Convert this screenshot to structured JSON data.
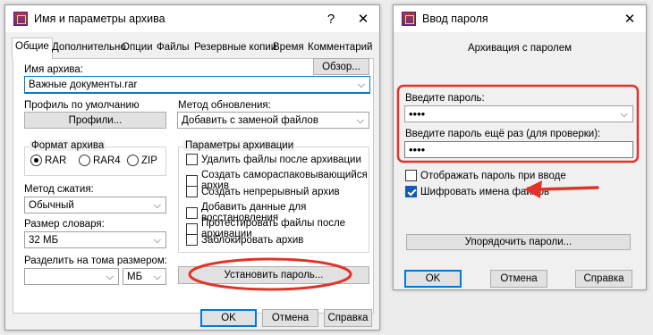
{
  "left_window": {
    "title": "Имя и параметры архива",
    "help_glyph": "?",
    "close_glyph": "✕",
    "tabs": [
      "Общие",
      "Дополнительно",
      "Опции",
      "Файлы",
      "Резервные копии",
      "Время",
      "Комментарий"
    ],
    "archive_name_label": "Имя архива:",
    "browse_button": "Обзор...",
    "archive_name_value": "Важные документы.rar",
    "profile_label": "Профиль по умолчанию",
    "profiles_button": "Профили...",
    "update_method_label": "Метод обновления:",
    "update_method_value": "Добавить с заменой файлов",
    "format_group_label": "Формат архива",
    "format_options": [
      "RAR",
      "RAR4",
      "ZIP"
    ],
    "params_group_label": "Параметры архивации",
    "params": [
      "Удалить файлы после архивации",
      "Создать самораспаковывающийся архив",
      "Создать непрерывный архив",
      "Добавить данные для восстановления",
      "Протестировать файлы после архивации",
      "Заблокировать архив"
    ],
    "compression_label": "Метод сжатия:",
    "compression_value": "Обычный",
    "dictionary_label": "Размер словаря:",
    "dictionary_value": "32 МБ",
    "split_label": "Разделить на тома размером:",
    "split_unit": "МБ",
    "set_password_button": "Установить пароль...",
    "ok_button": "OK",
    "cancel_button": "Отмена",
    "help_button": "Справка"
  },
  "right_window": {
    "title": "Ввод пароля",
    "close_glyph": "✕",
    "subtitle": "Архивация с паролем",
    "password_label": "Введите пароль:",
    "password_value": "••••",
    "confirm_label": "Введите пароль ещё раз (для проверки):",
    "confirm_value": "••••",
    "show_password_label": "Отображать пароль при вводе",
    "encrypt_names_label": "Шифровать имена файлов",
    "organize_button": "Упорядочить пароли...",
    "ok_button": "OK",
    "cancel_button": "Отмена",
    "help_button": "Справка"
  },
  "colors": {
    "annotation_red": "#e0342a",
    "accent_blue": "#0078d4"
  }
}
